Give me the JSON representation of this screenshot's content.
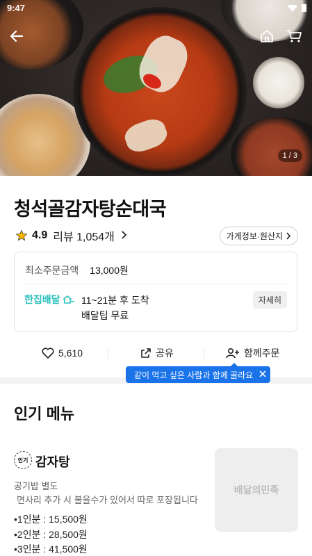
{
  "status_bar": {
    "time": "9:47"
  },
  "hero": {
    "counter": "1 / 3"
  },
  "store": {
    "name": "청석골감자탕순대국",
    "rating": "4.9",
    "reviews": "리뷰 1,054개",
    "info_button": "가게정보·원산지"
  },
  "info_card": {
    "min_order_label": "최소주문금액",
    "min_order_value": "13,000원",
    "delivery_logo": "한집배달",
    "delivery_time": "11~21분 후 도착",
    "delivery_tip": "배달팁 무료",
    "detail_button": "자세히"
  },
  "actions": {
    "like_count": "5,610",
    "share_label": "공유",
    "group_order_label": "함께주문"
  },
  "tooltip": {
    "text": "같이 먹고 싶은 사람과 함께 골라요"
  },
  "popular_section": {
    "title": "인기 메뉴",
    "item": {
      "badge": "인기",
      "name": "감자탕",
      "desc1": "공기밥 별도",
      "desc2": "면사리 추가 시 불을수가 있어서 따로 포장됩니다",
      "prices": [
        "•1인분 : 15,500원",
        "•2인분 : 28,500원",
        "•3인분 : 41,500원"
      ],
      "thumb_text": "배달의민족"
    }
  },
  "colors": {
    "accent_teal": "#2ac1bc",
    "tooltip_blue": "#1a73e8"
  }
}
